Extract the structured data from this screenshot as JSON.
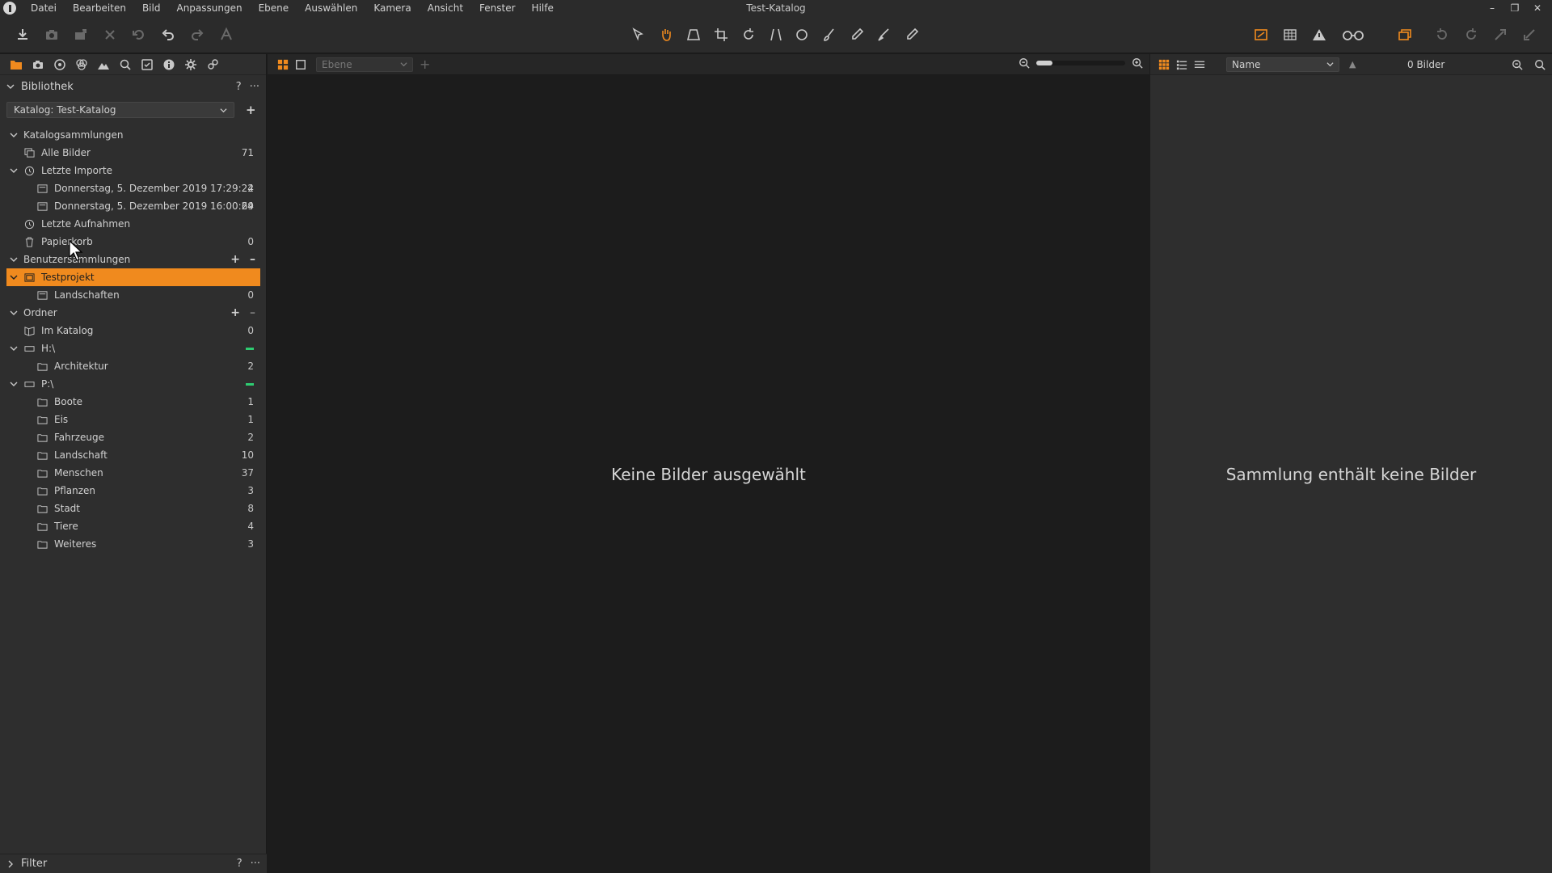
{
  "window": {
    "title": "Test-Katalog"
  },
  "menu": [
    "Datei",
    "Bearbeiten",
    "Bild",
    "Anpassungen",
    "Ebene",
    "Auswählen",
    "Kamera",
    "Ansicht",
    "Fenster",
    "Hilfe"
  ],
  "library": {
    "title": "Bibliothek",
    "help": "?",
    "more": "···",
    "catalog_label": "Katalog: Test-Katalog",
    "add": "+"
  },
  "tree": {
    "catalog_collections": "Katalogsammlungen",
    "all_images": {
      "label": "Alle Bilder",
      "count": "71"
    },
    "recent_imports": "Letzte Importe",
    "import1": {
      "label": "Donnerstag, 5. Dezember 2019 17:29:24",
      "count": "2"
    },
    "import2": {
      "label": "Donnerstag, 5. Dezember 2019 16:00:24",
      "count": "69"
    },
    "recent_captures": "Letzte Aufnahmen",
    "trash": {
      "label": "Papierkorb",
      "count": "0"
    },
    "user_collections": "Benutzersammlungen",
    "testprojekt": "Testprojekt",
    "landschaften": {
      "label": "Landschaften",
      "count": "0"
    },
    "folders": "Ordner",
    "in_catalog": {
      "label": "Im Katalog",
      "count": "0"
    },
    "drive_h": "H:\\",
    "architektur": {
      "label": "Architektur",
      "count": "2"
    },
    "drive_p": "P:\\",
    "p_folders": [
      {
        "label": "Boote",
        "count": "1"
      },
      {
        "label": "Eis",
        "count": "1"
      },
      {
        "label": "Fahrzeuge",
        "count": "2"
      },
      {
        "label": "Landschaft",
        "count": "10"
      },
      {
        "label": "Menschen",
        "count": "37"
      },
      {
        "label": "Pflanzen",
        "count": "3"
      },
      {
        "label": "Stadt",
        "count": "8"
      },
      {
        "label": "Tiere",
        "count": "4"
      },
      {
        "label": "Weiteres",
        "count": "3"
      }
    ]
  },
  "filter": {
    "title": "Filter",
    "help": "?",
    "more": "···"
  },
  "viewer": {
    "layer_placeholder": "Ebene",
    "message": "Keine Bilder ausgewählt"
  },
  "browser": {
    "sort": "Name",
    "count": "0 Bilder",
    "message": "Sammlung enthält keine Bilder"
  },
  "colors": {
    "accent": "#f08a1e",
    "online": "#2ecc71"
  }
}
